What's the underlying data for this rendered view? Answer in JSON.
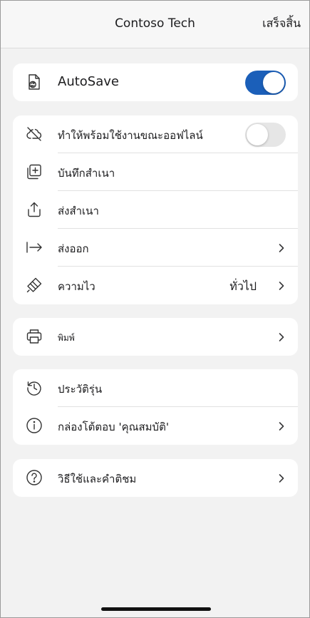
{
  "header": {
    "title": "Contoso Tech",
    "done_label": "เสร็จสิ้น"
  },
  "autosave": {
    "label": "AutoSave",
    "enabled": true
  },
  "file_group": {
    "offline": {
      "label": "ทำให้พร้อมใช้งานขณะออฟไลน์",
      "enabled": false
    },
    "save_copy": {
      "label": "บันทึกสำเนา"
    },
    "send_copy": {
      "label": "ส่งสำเนา"
    },
    "export": {
      "label": "ส่งออก"
    },
    "sensitivity": {
      "label": "ความไว",
      "value": "ทั่วไป"
    }
  },
  "print": {
    "label": "พิมพ์"
  },
  "info_group": {
    "version_history": {
      "label": "ประวัติรุ่น"
    },
    "properties": {
      "label": "กล่องโต้ตอบ 'คุณสมบัติ'"
    }
  },
  "help": {
    "label": "วิธีใช้และคำติชม"
  },
  "colors": {
    "accent": "#1b5fb9",
    "toggle_off": "#e6e6e6",
    "background": "#f2f2f2"
  },
  "icons": {
    "autosave": "file-sync-icon",
    "offline": "cloud-off-icon",
    "save_copy": "add-copy-icon",
    "send_copy": "share-icon",
    "export": "export-arrow-icon",
    "sensitivity": "sensitivity-tag-icon",
    "print": "printer-icon",
    "version_history": "history-icon",
    "properties": "info-icon",
    "help": "help-icon"
  }
}
